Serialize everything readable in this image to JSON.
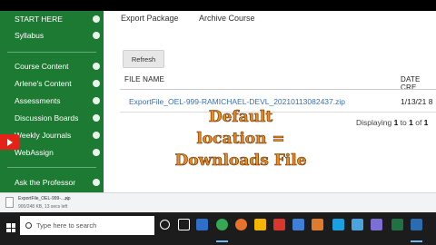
{
  "sidebar": {
    "items": [
      {
        "label": "START HERE"
      },
      {
        "label": "Syllabus"
      },
      {
        "label": "Course Content"
      },
      {
        "label": "Arlene's Content"
      },
      {
        "label": "Assessments"
      },
      {
        "label": "Discussion Boards"
      },
      {
        "label": "Weekly Journals"
      },
      {
        "label": "WebAssign"
      },
      {
        "label": "Ask the Professor"
      }
    ]
  },
  "main": {
    "tabs": [
      {
        "label": "Export Package"
      },
      {
        "label": "Archive Course"
      }
    ],
    "refresh_label": "Refresh",
    "table": {
      "columns": [
        "FILE NAME",
        "DATE CRE"
      ],
      "rows": [
        {
          "file": "ExportFile_OEL-999-RAMICHAEL-DEVL_20210113082437.zip",
          "date": "1/13/21 8"
        }
      ]
    },
    "paging": {
      "prefix": "Displaying ",
      "from": "1",
      "to_word": " to ",
      "to": "1",
      "of_word": " of ",
      "total": "1"
    }
  },
  "overlay": {
    "lines": [
      "Default",
      "location =",
      "Downloads File"
    ],
    "color": "#f08a1a"
  },
  "download_bar": {
    "file_name": "ExportFile_OEL-999-...zip",
    "status": "900/248 KB, 13 secs left"
  },
  "taskbar": {
    "search_placeholder": "Type here to search"
  },
  "colors": {
    "sidebar_bg": "#1d7a33",
    "link": "#3a6fb4",
    "youtube_red": "#e62117"
  }
}
